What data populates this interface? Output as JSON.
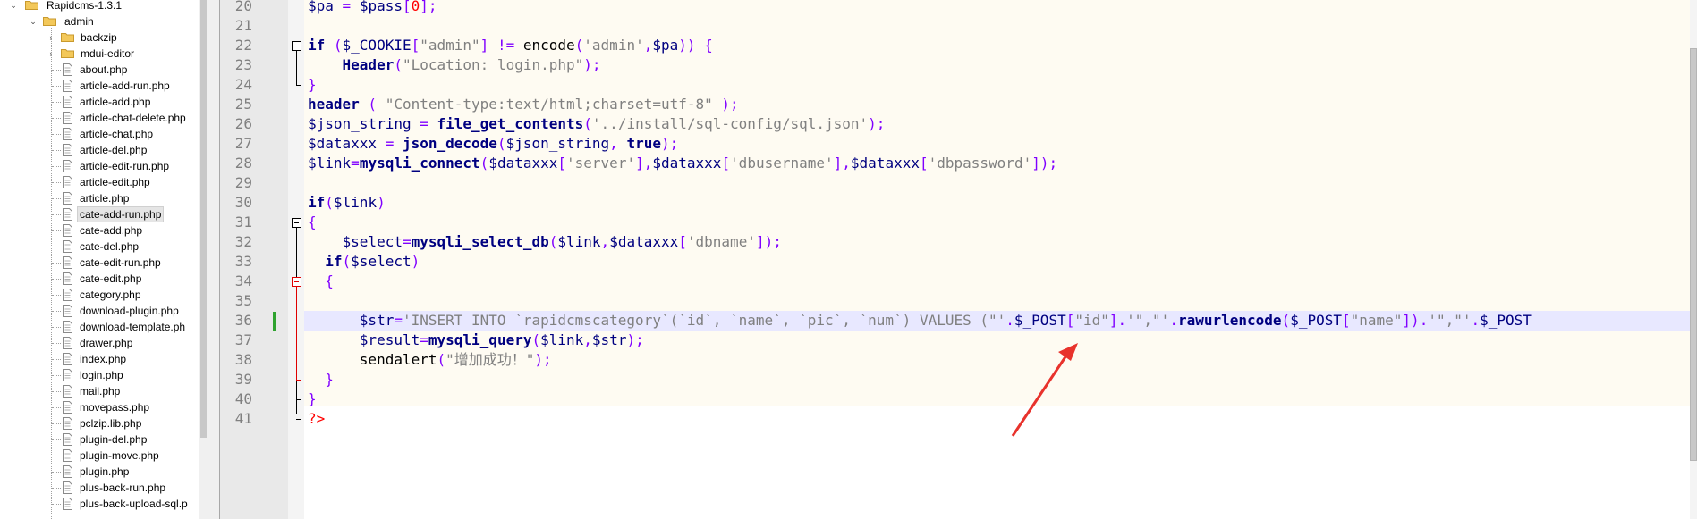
{
  "file_tree": {
    "root": "Rapidcms-1.3.1",
    "folder": "admin",
    "subfolders": [
      "backzip",
      "mdui-editor"
    ],
    "files": [
      "about.php",
      "article-add-run.php",
      "article-add.php",
      "article-chat-delete.php",
      "article-chat.php",
      "article-del.php",
      "article-edit-run.php",
      "article-edit.php",
      "article.php",
      "cate-add-run.php",
      "cate-add.php",
      "cate-del.php",
      "cate-edit-run.php",
      "cate-edit.php",
      "category.php",
      "download-plugin.php",
      "download-template.ph",
      "drawer.php",
      "index.php",
      "login.php",
      "mail.php",
      "movepass.php",
      "pclzip.lib.php",
      "plugin-del.php",
      "plugin-move.php",
      "plugin.php",
      "plus-back-run.php",
      "plus-back-upload-sql.p"
    ],
    "selected_file": "cate-add-run.php"
  },
  "editor": {
    "current_line": "36",
    "lines": [
      {
        "n": "20",
        "tokens": [
          {
            "t": "$pa",
            "c": "var"
          },
          {
            "t": " = ",
            "c": "op"
          },
          {
            "t": "$pass",
            "c": "var"
          },
          {
            "t": "[",
            "c": "punc"
          },
          {
            "t": "0",
            "c": "php"
          },
          {
            "t": "];",
            "c": "punc"
          }
        ]
      },
      {
        "n": "21",
        "tokens": []
      },
      {
        "n": "22",
        "tokens": [
          {
            "t": "if",
            "c": "kw"
          },
          {
            "t": " (",
            "c": "punc"
          },
          {
            "t": "$_COOKIE",
            "c": "var"
          },
          {
            "t": "[",
            "c": "punc"
          },
          {
            "t": "\"admin\"",
            "c": "str"
          },
          {
            "t": "] != ",
            "c": "punc"
          },
          {
            "t": "encode",
            "c": "plain"
          },
          {
            "t": "(",
            "c": "punc"
          },
          {
            "t": "'admin'",
            "c": "str"
          },
          {
            "t": ",",
            "c": "punc"
          },
          {
            "t": "$pa",
            "c": "var"
          },
          {
            "t": ")) {",
            "c": "punc"
          }
        ]
      },
      {
        "n": "23",
        "tokens": [
          {
            "t": "    ",
            "c": "plain"
          },
          {
            "t": "Header",
            "c": "fn"
          },
          {
            "t": "(",
            "c": "punc"
          },
          {
            "t": "\"Location: login.php\"",
            "c": "str"
          },
          {
            "t": ");",
            "c": "punc"
          }
        ]
      },
      {
        "n": "24",
        "tokens": [
          {
            "t": "}",
            "c": "brace"
          }
        ]
      },
      {
        "n": "25",
        "tokens": [
          {
            "t": "header",
            "c": "kw"
          },
          {
            "t": " ( ",
            "c": "punc"
          },
          {
            "t": "\"Content-type:text/html;charset=utf-8\"",
            "c": "str"
          },
          {
            "t": " );",
            "c": "punc"
          }
        ]
      },
      {
        "n": "26",
        "tokens": [
          {
            "t": "$json_string",
            "c": "var"
          },
          {
            "t": " = ",
            "c": "op"
          },
          {
            "t": "file_get_contents",
            "c": "fn"
          },
          {
            "t": "(",
            "c": "punc"
          },
          {
            "t": "'../install/sql-config/sql.json'",
            "c": "str"
          },
          {
            "t": ");",
            "c": "punc"
          }
        ]
      },
      {
        "n": "27",
        "tokens": [
          {
            "t": "$dataxxx",
            "c": "var"
          },
          {
            "t": " = ",
            "c": "op"
          },
          {
            "t": "json_decode",
            "c": "fn"
          },
          {
            "t": "(",
            "c": "punc"
          },
          {
            "t": "$json_string",
            "c": "var"
          },
          {
            "t": ", ",
            "c": "punc"
          },
          {
            "t": "true",
            "c": "kw"
          },
          {
            "t": ");",
            "c": "punc"
          }
        ]
      },
      {
        "n": "28",
        "tokens": [
          {
            "t": "$link",
            "c": "var"
          },
          {
            "t": "=",
            "c": "op"
          },
          {
            "t": "mysqli_connect",
            "c": "fn"
          },
          {
            "t": "(",
            "c": "punc"
          },
          {
            "t": "$dataxxx",
            "c": "var"
          },
          {
            "t": "[",
            "c": "punc"
          },
          {
            "t": "'server'",
            "c": "str"
          },
          {
            "t": "],",
            "c": "punc"
          },
          {
            "t": "$dataxxx",
            "c": "var"
          },
          {
            "t": "[",
            "c": "punc"
          },
          {
            "t": "'dbusername'",
            "c": "str"
          },
          {
            "t": "],",
            "c": "punc"
          },
          {
            "t": "$dataxxx",
            "c": "var"
          },
          {
            "t": "[",
            "c": "punc"
          },
          {
            "t": "'dbpassword'",
            "c": "str"
          },
          {
            "t": "]);",
            "c": "punc"
          }
        ]
      },
      {
        "n": "29",
        "tokens": []
      },
      {
        "n": "30",
        "tokens": [
          {
            "t": "if",
            "c": "kw"
          },
          {
            "t": "(",
            "c": "punc"
          },
          {
            "t": "$link",
            "c": "var"
          },
          {
            "t": ")",
            "c": "punc"
          }
        ]
      },
      {
        "n": "31",
        "tokens": [
          {
            "t": "{",
            "c": "brace"
          }
        ]
      },
      {
        "n": "32",
        "tokens": [
          {
            "t": "    ",
            "c": "plain"
          },
          {
            "t": "$select",
            "c": "var"
          },
          {
            "t": "=",
            "c": "op"
          },
          {
            "t": "mysqli_select_db",
            "c": "fn"
          },
          {
            "t": "(",
            "c": "punc"
          },
          {
            "t": "$link",
            "c": "var"
          },
          {
            "t": ",",
            "c": "punc"
          },
          {
            "t": "$dataxxx",
            "c": "var"
          },
          {
            "t": "[",
            "c": "punc"
          },
          {
            "t": "'dbname'",
            "c": "str"
          },
          {
            "t": "]);",
            "c": "punc"
          }
        ]
      },
      {
        "n": "33",
        "tokens": [
          {
            "t": "  ",
            "c": "plain"
          },
          {
            "t": "if",
            "c": "kw"
          },
          {
            "t": "(",
            "c": "punc"
          },
          {
            "t": "$select",
            "c": "var"
          },
          {
            "t": ")",
            "c": "punc"
          }
        ]
      },
      {
        "n": "34",
        "tokens": [
          {
            "t": "  ",
            "c": "plain"
          },
          {
            "t": "{",
            "c": "brace"
          }
        ]
      },
      {
        "n": "35",
        "tokens": []
      },
      {
        "n": "36",
        "tokens": [
          {
            "t": "      ",
            "c": "plain"
          },
          {
            "t": "$str",
            "c": "var"
          },
          {
            "t": "=",
            "c": "op"
          },
          {
            "t": "'INSERT INTO `rapidcmscategory`(`id`, `name`, `pic`, `num`) VALUES (\"'",
            "c": "str"
          },
          {
            "t": ".",
            "c": "op"
          },
          {
            "t": "$_POST",
            "c": "var"
          },
          {
            "t": "[",
            "c": "punc"
          },
          {
            "t": "\"id\"",
            "c": "str"
          },
          {
            "t": "].",
            "c": "punc"
          },
          {
            "t": "'\",\"'",
            "c": "str"
          },
          {
            "t": ".",
            "c": "op"
          },
          {
            "t": "rawurlencode",
            "c": "fn"
          },
          {
            "t": "(",
            "c": "punc"
          },
          {
            "t": "$_POST",
            "c": "var"
          },
          {
            "t": "[",
            "c": "punc"
          },
          {
            "t": "\"name\"",
            "c": "str"
          },
          {
            "t": "]).",
            "c": "punc"
          },
          {
            "t": "'\",\"'",
            "c": "str"
          },
          {
            "t": ".",
            "c": "op"
          },
          {
            "t": "$_POST",
            "c": "var"
          }
        ]
      },
      {
        "n": "37",
        "tokens": [
          {
            "t": "      ",
            "c": "plain"
          },
          {
            "t": "$result",
            "c": "var"
          },
          {
            "t": "=",
            "c": "op"
          },
          {
            "t": "mysqli_query",
            "c": "fn"
          },
          {
            "t": "(",
            "c": "punc"
          },
          {
            "t": "$link",
            "c": "var"
          },
          {
            "t": ",",
            "c": "punc"
          },
          {
            "t": "$str",
            "c": "var"
          },
          {
            "t": ");",
            "c": "punc"
          }
        ]
      },
      {
        "n": "38",
        "tokens": [
          {
            "t": "      ",
            "c": "plain"
          },
          {
            "t": "sendalert",
            "c": "plain"
          },
          {
            "t": "(",
            "c": "punc"
          },
          {
            "t": "\"增加成功！\"",
            "c": "str"
          },
          {
            "t": ");",
            "c": "punc"
          }
        ]
      },
      {
        "n": "39",
        "tokens": [
          {
            "t": "  ",
            "c": "plain"
          },
          {
            "t": "}",
            "c": "brace"
          }
        ]
      },
      {
        "n": "40",
        "tokens": [
          {
            "t": "}",
            "c": "brace"
          }
        ]
      },
      {
        "n": "41",
        "tokens": [
          {
            "t": "?>",
            "c": "php"
          }
        ]
      }
    ]
  },
  "colors": {
    "annotation_arrow": "#e8322c",
    "keyword": "#000080",
    "string": "#808080",
    "operator": "#8000ff",
    "current_line_bg": "#e8e8ff"
  }
}
